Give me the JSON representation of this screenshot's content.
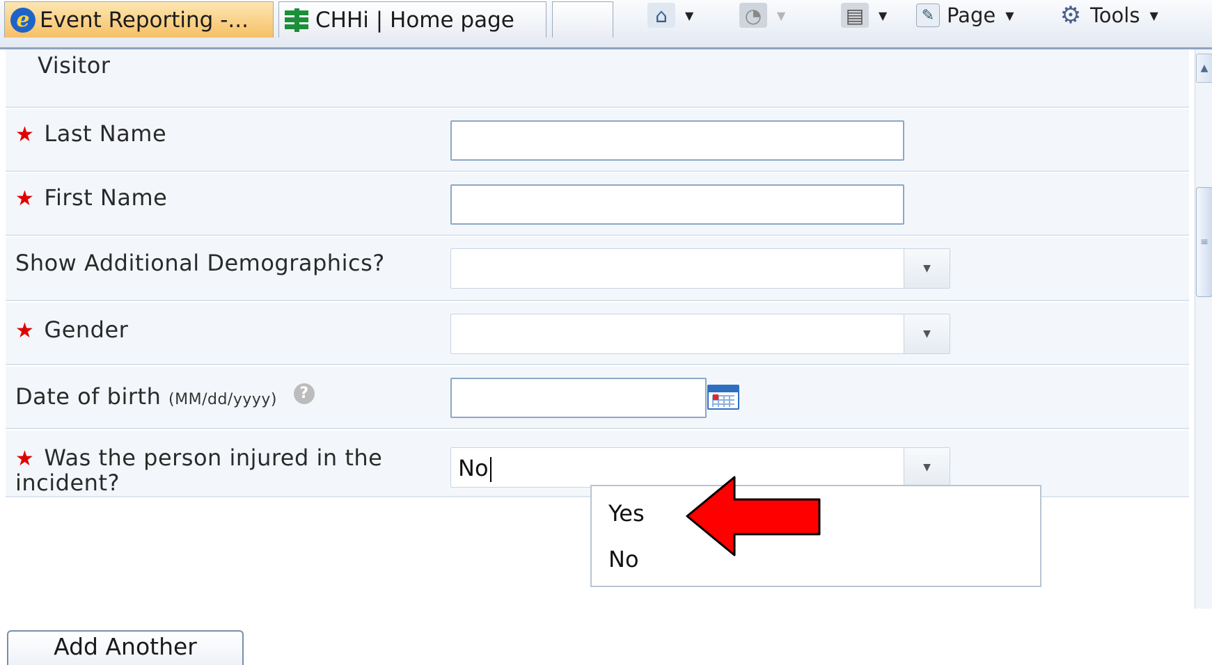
{
  "browser": {
    "tabs": [
      {
        "label": "Event Reporting -..."
      },
      {
        "label": "CHHi | Home page"
      }
    ],
    "toolbar": {
      "page_label": "Page",
      "tools_label": "Tools"
    }
  },
  "form": {
    "top_row_label": "Visitor",
    "last_name": {
      "label": "Last Name",
      "value": "",
      "required": true
    },
    "first_name": {
      "label": "First Name",
      "value": "",
      "required": true
    },
    "show_demographics": {
      "label": "Show Additional Demographics?",
      "value": ""
    },
    "gender": {
      "label": "Gender",
      "value": "",
      "required": true
    },
    "dob": {
      "label": "Date of birth",
      "format_hint": "(MM/dd/yyyy)",
      "help_icon": "?",
      "value": ""
    },
    "injured": {
      "label": "Was the person injured in the incident?",
      "value": "No",
      "required": true
    },
    "dropdown_options": [
      "Yes",
      "No"
    ],
    "add_another_label": "Add Another",
    "required_marker": "★"
  },
  "colors": {
    "required_star": "#e00000",
    "annotation_arrow": "#ff0000",
    "row_background": "#f3f7fb",
    "input_border": "#8da6c4"
  }
}
